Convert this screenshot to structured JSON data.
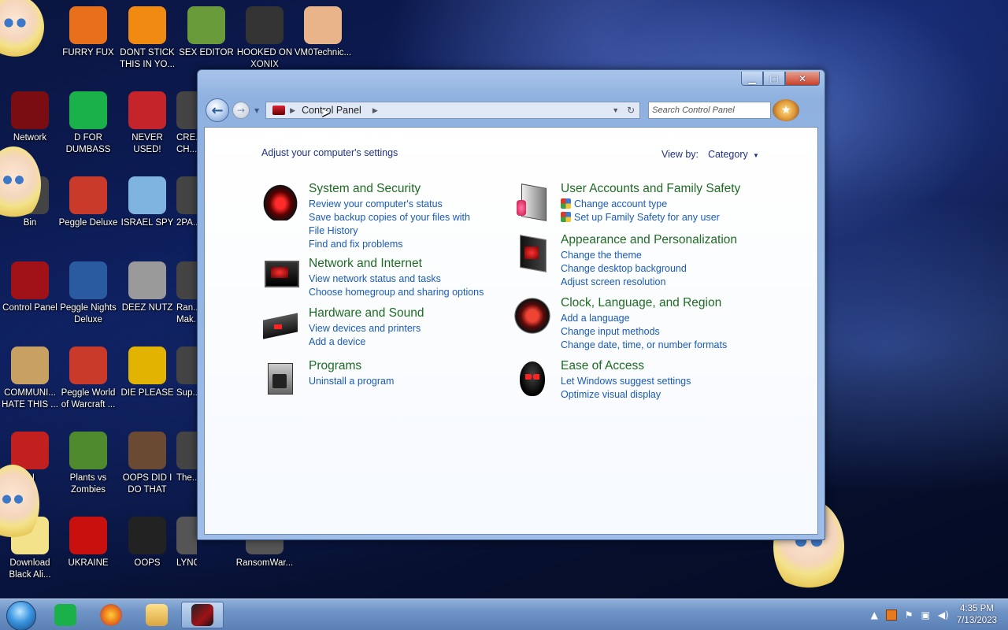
{
  "desktop": {
    "icons": [
      {
        "label": "FURRY FUX",
        "icon": "firefox-icon",
        "color": "#e8701a"
      },
      {
        "label": "DONT STICK THIS IN YO...",
        "icon": "vlc-cone-icon",
        "color": "#f08a10"
      },
      {
        "label": "SEX EDITOR",
        "icon": "hxd-icon",
        "color": "#6a9b3a"
      },
      {
        "label": "HOOKED ON XONIX",
        "icon": "xonix-icon",
        "color": "#333333"
      },
      {
        "label": "VM0Technic...",
        "icon": "doctor-icon",
        "color": "#e9b48a"
      },
      {
        "label": "Network",
        "icon": "network-icon",
        "color": "#7a0d12"
      },
      {
        "label": "D FOR DUMBASS",
        "icon": "notes-icon",
        "color": "#1ab04a"
      },
      {
        "label": "NEVER USED!",
        "icon": "devcpp-icon",
        "color": "#c4242a"
      },
      {
        "label": "CRE... CH...",
        "icon": "partial-icon",
        "color": "#444444"
      },
      {
        "label": "Bin",
        "icon": "recycle-bin-icon",
        "color": "#444444"
      },
      {
        "label": "Peggle Deluxe",
        "icon": "peggle-icon",
        "color": "#c93a2a"
      },
      {
        "label": "ISRAEL SPY",
        "icon": "spy-icon",
        "color": "#7fb3e0"
      },
      {
        "label": "2PA...",
        "icon": "partial-icon",
        "color": "#444444"
      },
      {
        "label": "Control Panel",
        "icon": "control-panel-icon",
        "color": "#a01218"
      },
      {
        "label": "Peggle Nights Deluxe",
        "icon": "peggle-nights-icon",
        "color": "#2a5aa0"
      },
      {
        "label": "DEEZ NUTZ",
        "icon": "windows-icon",
        "color": "#9a9a9a"
      },
      {
        "label": "Ran... Mak...",
        "icon": "partial-icon",
        "color": "#444444"
      },
      {
        "label": "COMMUNI... HATE THIS ...",
        "icon": "money-bag-icon",
        "color": "#c8a062"
      },
      {
        "label": "Peggle World of Warcraft ...",
        "icon": "peggle-wow-icon",
        "color": "#c93a2a"
      },
      {
        "label": "DIE PLEASE",
        "icon": "de-icon",
        "color": "#e2b300"
      },
      {
        "label": "Sup...",
        "icon": "partial-icon",
        "color": "#444444"
      },
      {
        "label": "IN",
        "icon": "partial-icon",
        "color": "#c21f1f"
      },
      {
        "label": "Plants vs Zombies",
        "icon": "plant-icon",
        "color": "#4f8a2f"
      },
      {
        "label": "OOPS DID I DO THAT",
        "icon": "portrait-icon",
        "color": "#6b4a33"
      },
      {
        "label": "The...",
        "icon": "partial-icon",
        "color": "#444444"
      },
      {
        "label": "Download Black Ali...",
        "icon": "star-butterfly-icon",
        "color": "#f4e28a"
      },
      {
        "label": "UKRAINE",
        "icon": "radiation-icon",
        "color": "#c8100e"
      },
      {
        "label": "OOPS",
        "icon": "shortcut-icon",
        "color": "#222222"
      },
      {
        "label": "LYNCHING",
        "icon": "shortcut-icon",
        "color": "#555555"
      },
      {
        "label": "RansomWar...",
        "icon": "gear-icon",
        "color": "#555555"
      }
    ]
  },
  "window": {
    "controls": {
      "minimize": "▁",
      "maximize": "□",
      "close": "✕"
    },
    "address": {
      "path": "Control Panel"
    },
    "search": {
      "placeholder": "Search Control Panel"
    },
    "header": {
      "adjust": "Adjust your computer's settings",
      "view_by_label": "View by:",
      "view_by_value": "Category"
    },
    "categories_left": [
      {
        "title": "System and Security",
        "icon": "security-icon",
        "links": [
          "Review your computer's status",
          "Save backup copies of your files with File History",
          "Find and fix problems"
        ]
      },
      {
        "title": "Network and Internet",
        "icon": "network-icon",
        "links": [
          "View network status and tasks",
          "Choose homegroup and sharing options"
        ]
      },
      {
        "title": "Hardware and Sound",
        "icon": "hardware-icon",
        "links": [
          "View devices and printers",
          "Add a device"
        ]
      },
      {
        "title": "Programs",
        "icon": "programs-icon",
        "links": [
          "Uninstall a program"
        ]
      }
    ],
    "categories_right": [
      {
        "title": "User Accounts and Family Safety",
        "icon": "user-accounts-icon",
        "links": [
          "Change account type",
          "Set up Family Safety for any user"
        ]
      },
      {
        "title": "Appearance and Personalization",
        "icon": "appearance-icon",
        "links": [
          "Change the theme",
          "Change desktop background",
          "Adjust screen resolution"
        ]
      },
      {
        "title": "Clock, Language, and Region",
        "icon": "clock-icon",
        "links": [
          "Add a language",
          "Change input methods",
          "Change date, time, or number formats"
        ]
      },
      {
        "title": "Ease of Access",
        "icon": "ease-of-access-icon",
        "links": [
          "Let Windows suggest settings",
          "Optimize visual display"
        ]
      }
    ]
  },
  "taskbar": {
    "items": [
      "start-orb-icon",
      "notes-icon",
      "firefox-icon",
      "explorer-folder-icon",
      "control-panel-icon"
    ],
    "clock": {
      "time": "4:35 PM",
      "date": "7/13/2023"
    }
  },
  "colors": {
    "link": "#1a5bb8",
    "category_title": "#1e6b24",
    "header_text": "#1e3287"
  }
}
